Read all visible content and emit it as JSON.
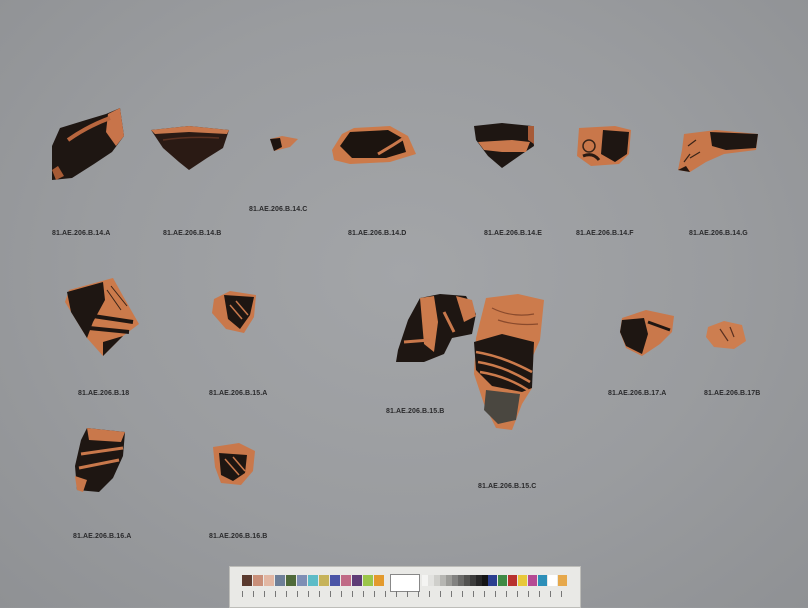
{
  "labels": {
    "b14a": "81.AE.206.B.14.A",
    "b14b": "81.AE.206.B.14.B",
    "b14c": "81.AE.206.B.14.C",
    "b14d": "81.AE.206.B.14.D",
    "b14e": "81.AE.206.B.14.E",
    "b14f": "81.AE.206.B.14.F",
    "b14g": "81.AE.206.B.14.G",
    "b18": "81.AE.206.B.18",
    "b15a": "81.AE.206.B.15.A",
    "b15b": "81.AE.206.B.15.B",
    "b15c": "81.AE.206.B.15.C",
    "b17a": "81.AE.206.B.17.A",
    "b17b": "81.AE.206.B.17B",
    "b16a": "81.AE.206.B.16.A",
    "b16b": "81.AE.206.B.16.B"
  },
  "color_card": {
    "left_note": "",
    "right_note": "",
    "colors": [
      "#5a3a2e",
      "#c98f79",
      "#e2b7a3",
      "#6e7f98",
      "#4f6a3a",
      "#7f8fb5",
      "#5dbcc7",
      "#c6b35a",
      "#4b55a6",
      "#c06a86",
      "#5e3c76",
      "#9bc64a",
      "#e39a2d"
    ],
    "colors_right": [
      "#2b3f8f",
      "#3f8a45",
      "#b8322f",
      "#e8c83a",
      "#b54a93",
      "#2d8fb8",
      "#ffffff",
      "#e6a84b"
    ],
    "grays": [
      "#f4f4f2",
      "#e2e2df",
      "#cfcfcb",
      "#b6b6b2",
      "#9c9c98",
      "#828280",
      "#6a6a68",
      "#525250",
      "#3c3c3b",
      "#262626",
      "#141414"
    ]
  }
}
